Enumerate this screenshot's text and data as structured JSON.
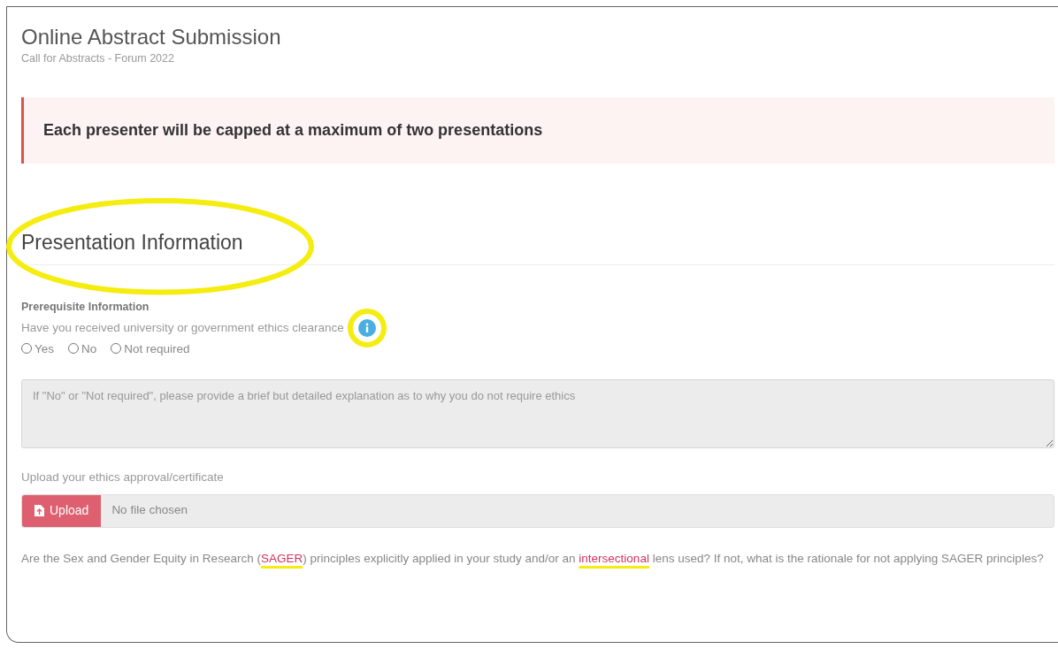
{
  "header": {
    "title": "Online Abstract Submission",
    "subtitle": "Call for Abstracts - Forum 2022"
  },
  "notice": "Each presenter will be capped at a maximum of two presentations",
  "section": {
    "title": "Presentation Information"
  },
  "prerequisite": {
    "heading": "Prerequisite Information",
    "question": "Have you received university or government ethics clearance",
    "options": [
      {
        "label": "Yes",
        "selected": false
      },
      {
        "label": "No",
        "selected": false
      },
      {
        "label": "Not required",
        "selected": false
      }
    ],
    "explanation": {
      "placeholder": "If \"No\" or \"Not required\", please provide a brief but detailed explanation as to why you do not require ethics"
    }
  },
  "upload": {
    "label": "Upload your ethics approval/certificate",
    "button": "Upload",
    "status": "No file chosen"
  },
  "sager_question": [
    {
      "kind": "text",
      "text": "Are the Sex and Gender Equity in Research ("
    },
    {
      "kind": "link",
      "text": "SAGER"
    },
    {
      "kind": "text",
      "text": ") principles explicitly applied in your study and/or an "
    },
    {
      "kind": "link",
      "text": "intersectional"
    },
    {
      "kind": "text",
      "text": " lens used? If not, what is the rationale for not applying SAGER principles?"
    }
  ]
}
